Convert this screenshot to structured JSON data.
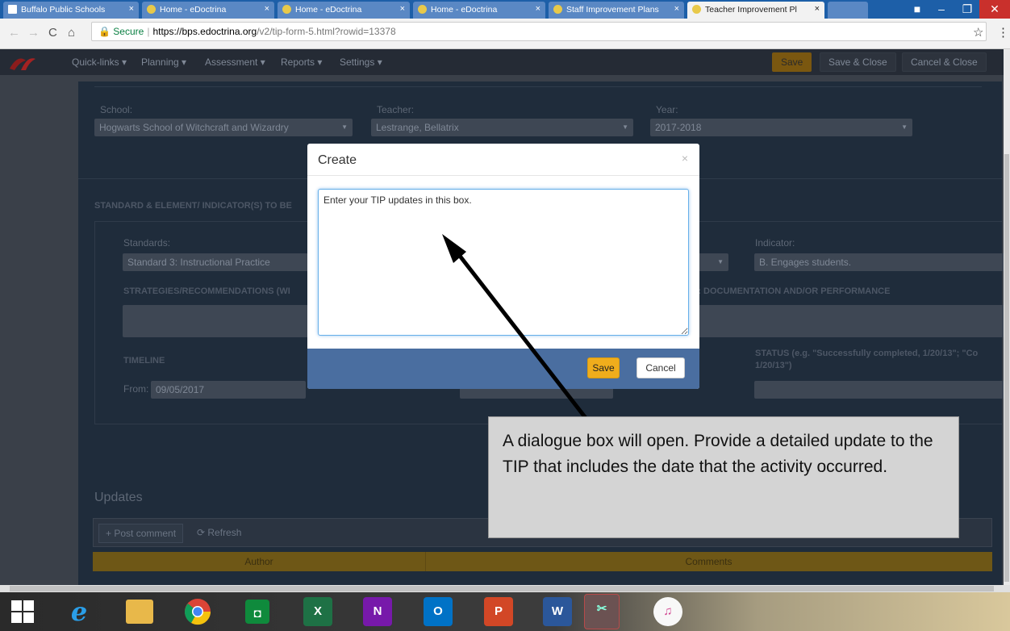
{
  "browser": {
    "tabs": [
      {
        "title": "Buffalo Public Schools"
      },
      {
        "title": "Home - eDoctrina"
      },
      {
        "title": "Home - eDoctrina"
      },
      {
        "title": "Home - eDoctrina"
      },
      {
        "title": "Staff Improvement Plans"
      },
      {
        "title": "Teacher Improvement Pl"
      }
    ],
    "secure_label": "Secure",
    "url_scheme_host": "https://bps.edoctrina.org",
    "url_path": "/v2/tip-form-5.html?rowid=13378",
    "close_glyph": "×"
  },
  "app": {
    "menu": [
      "Quick-links ▾",
      "Planning ▾",
      "Assessment ▾",
      "Reports ▾",
      "Settings ▾"
    ],
    "save": "Save",
    "save_close": "Save & Close",
    "cancel_close": "Cancel & Close"
  },
  "form": {
    "school_label": "School:",
    "school_value": "Hogwarts School of Witchcraft and Wizardry",
    "teacher_label": "Teacher:",
    "teacher_value": "Lestrange, Bellatrix",
    "year_label": "Year:",
    "year_value": "2017-2018",
    "section_heading": "STANDARD & ELEMENT/ INDICATOR(S) TO BE",
    "standards_label": "Standards:",
    "standards_value": "Standard 3: Instructional Practice",
    "indicator_label": "Indicator:",
    "indicator_value": "B. Engages students.",
    "strategies_heading": "STRATEGIES/RECOMMENDATIONS (WI",
    "documentation_heading": "E: DOCUMENTATION AND/OR PERFORMANCE",
    "timeline_heading": "TIMELINE",
    "from_label": "From:",
    "from_value": "09/05/2017",
    "status_heading": "STATUS (e.g. \"Successfully completed, 1/20/13\"; \"Co 1/20/13\")",
    "updates_heading": "Updates",
    "post_comment": "+ Post comment",
    "refresh": "⟳ Refresh",
    "author_col": "Author",
    "comments_col": "Comments"
  },
  "modal": {
    "title": "Create",
    "close": "×",
    "text": "Enter your TIP updates in this box.",
    "save": "Save",
    "cancel": "Cancel"
  },
  "callout": {
    "text": "A dialogue box will open.  Provide a detailed update to the TIP that includes the date that the activity occurred."
  },
  "taskbar": {
    "apps": [
      "windows-start",
      "internet-explorer",
      "file-explorer",
      "chrome",
      "store",
      "excel",
      "onenote",
      "outlook",
      "powerpoint",
      "word",
      "snipping-tool",
      "itunes"
    ]
  },
  "colors": {
    "accent": "#f0ad1c",
    "modal_footer": "#4a6ea0",
    "overlay_bg": "#3a4049"
  }
}
